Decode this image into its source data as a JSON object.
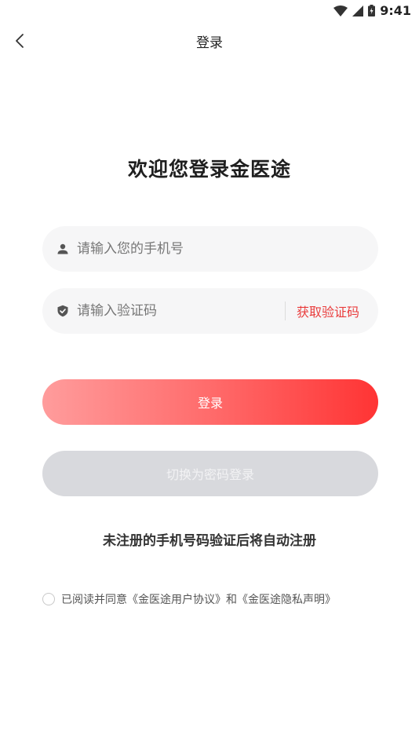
{
  "status_bar": {
    "time": "9:41",
    "icons": [
      "wifi-icon",
      "signal-icon",
      "battery-icon"
    ]
  },
  "nav": {
    "back_icon": "chevron-left-icon",
    "title": "登录"
  },
  "welcome": "欢迎您登录金医途",
  "phone_field": {
    "icon": "user-icon",
    "placeholder": "请输入您的手机号",
    "value": ""
  },
  "code_field": {
    "icon": "shield-icon",
    "placeholder": "请输入验证码",
    "value": "",
    "get_code_label": "获取验证码"
  },
  "login_button": "登录",
  "switch_button": "切换为密码登录",
  "notice": "未注册的手机号码验证后将自动注册",
  "agreement": {
    "text": "已阅读并同意《金医途用户协议》和《金医途隐私声明》",
    "checked": false
  },
  "colors": {
    "accent": "#ff3434",
    "accent_light": "#ff9c9c",
    "link": "#e93c3c",
    "disabled": "#d8d9dd"
  }
}
